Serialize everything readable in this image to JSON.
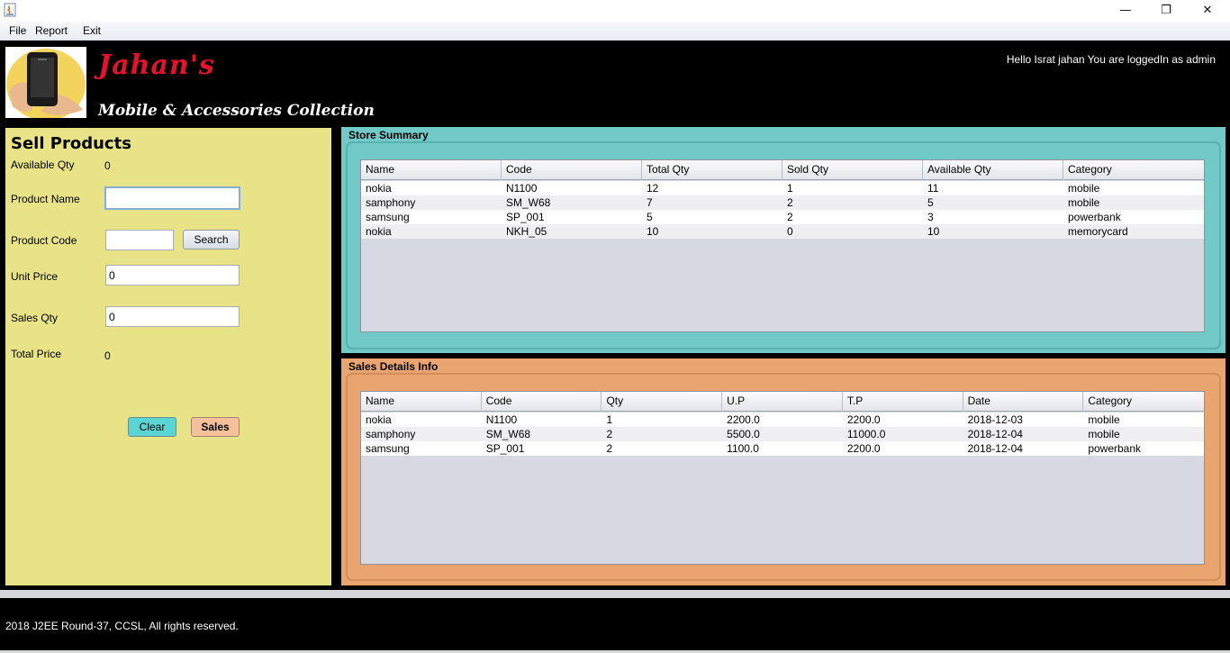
{
  "window": {
    "minimize": "—",
    "maximize": "❐",
    "close": "✕"
  },
  "menu": [
    "File",
    "Report",
    "Exit"
  ],
  "header": {
    "brand_name": "Jahan's",
    "brand_subtitle": "Mobile & Accessories Collection",
    "greeting": "Hello Israt jahan You are loggedIn as admin"
  },
  "sell": {
    "title": "Sell  Products",
    "available_qty_label": "Available Qty",
    "available_qty_value": "0",
    "product_name_label": "Product Name",
    "product_name_value": "",
    "product_code_label": "Product Code",
    "product_code_value": "",
    "search_label": "Search",
    "unit_price_label": "Unit Price",
    "unit_price_value": "0",
    "sales_qty_label": "Sales Qty",
    "sales_qty_value": "0",
    "total_price_label": "Total Price",
    "total_price_value": "0",
    "clear_label": "Clear",
    "sales_label": "Sales"
  },
  "store_summary": {
    "title": "Store Summary",
    "columns": [
      "Name",
      "Code",
      "Total Qty",
      "Sold Qty",
      "Available Qty",
      "Category"
    ],
    "rows": [
      [
        "nokia",
        "N1100",
        "12",
        "1",
        "11",
        "mobile"
      ],
      [
        "samphony",
        "SM_W68",
        "7",
        "2",
        "5",
        "mobile"
      ],
      [
        "samsung",
        "SP_001",
        "5",
        "2",
        "3",
        "powerbank"
      ],
      [
        "nokia",
        "NKH_05",
        "10",
        "0",
        "10",
        "memorycard"
      ]
    ]
  },
  "sales_details": {
    "title": "Sales Details Info",
    "columns": [
      "Name",
      "Code",
      "Qty",
      "U.P",
      "T.P",
      "Date",
      "Category"
    ],
    "rows": [
      [
        "nokia",
        "N1100",
        "1",
        "2200.0",
        "2200.0",
        "2018-12-03",
        "mobile"
      ],
      [
        "samphony",
        "SM_W68",
        "2",
        "5500.0",
        "11000.0",
        "2018-12-04",
        "mobile"
      ],
      [
        "samsung",
        "SP_001",
        "2",
        "1100.0",
        "2200.0",
        "2018-12-04",
        "powerbank"
      ]
    ]
  },
  "footer": {
    "text": "2018 J2EE Round-37, CCSL, All rights reserved."
  },
  "colors": {
    "sell_panel": "#e7e386",
    "store_panel": "#71c9c8",
    "sales_panel": "#e9a46f",
    "brand_red": "#e8102a"
  }
}
